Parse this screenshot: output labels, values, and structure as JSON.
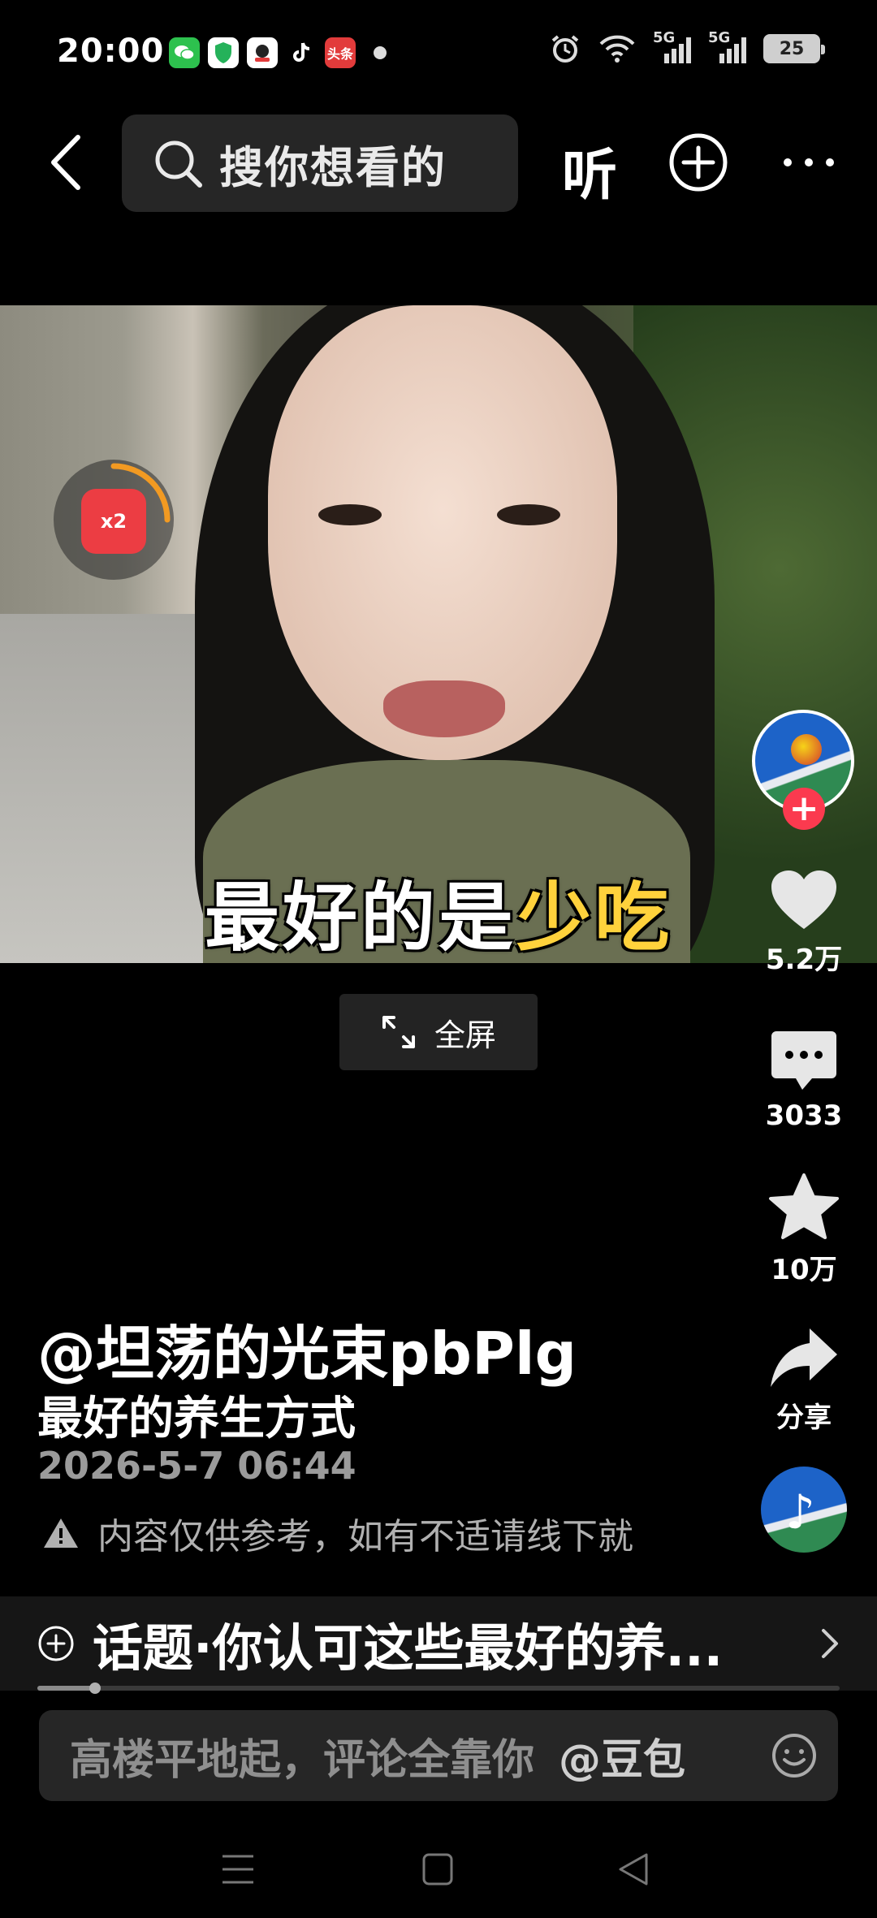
{
  "status_bar": {
    "time": "20:00",
    "apps": [
      {
        "icon": "wechat-icon",
        "color": "#2dc14e"
      },
      {
        "icon": "shield-icon",
        "color": "#ffffff"
      },
      {
        "icon": "app-icon",
        "color": "#ffffff"
      },
      {
        "icon": "tiktok-icon",
        "color": "#000000"
      },
      {
        "icon": "toutiao-icon",
        "color": "#e23b3b",
        "label": "头条"
      }
    ],
    "network_1": "5G",
    "network_2": "5G",
    "battery": "25"
  },
  "top_nav": {
    "search_placeholder": "搜你想看的",
    "listen_label": "听"
  },
  "video": {
    "caption_main": "最好的是",
    "caption_highlight": "少吃",
    "redpacket_label": "x2"
  },
  "fullscreen_label": "全屏",
  "actions": {
    "likes": "5.2万",
    "comments": "3033",
    "favorites": "10万",
    "share": "分享"
  },
  "post": {
    "author": "@坦荡的光束pbPlg",
    "description": "最好的养生方式",
    "timestamp": "2026-5-7 06:44",
    "disclaimer": "内容仅供参考，如有不适请线下就"
  },
  "topic": {
    "text": "话题·你认可这些最好的养..."
  },
  "progress": {
    "fraction": 0.072
  },
  "comment": {
    "placeholder": "高楼平地起，评论全靠你",
    "mention": "@豆包"
  },
  "colors": {
    "accent_red": "#fb3a4f",
    "caption_highlight": "#ffd23c"
  }
}
